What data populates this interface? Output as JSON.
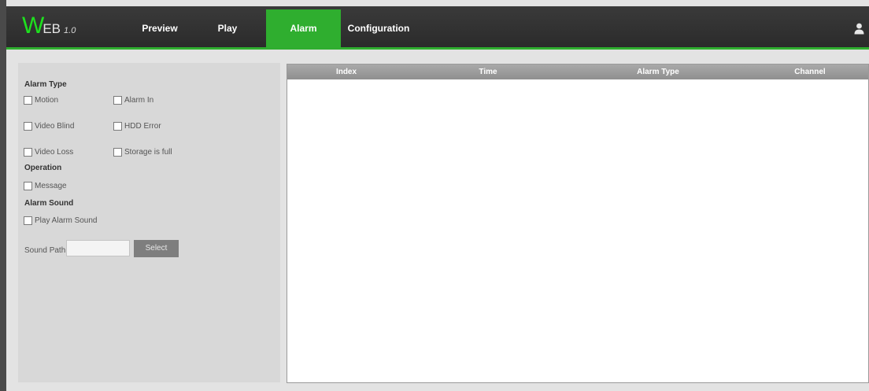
{
  "logo": {
    "letter": "W",
    "text": "EB",
    "version": "1.0"
  },
  "nav": {
    "tabs": [
      {
        "label": "Preview"
      },
      {
        "label": "Play"
      },
      {
        "label": "Alarm",
        "active": true
      },
      {
        "label": "Configuration"
      }
    ]
  },
  "header_icons": {
    "user": "user-icon"
  },
  "sidebar": {
    "alarm_type_title": "Alarm Type",
    "alarm_types": [
      {
        "label": "Motion",
        "checked": false
      },
      {
        "label": "Alarm In",
        "checked": false
      },
      {
        "label": "Video Blind",
        "checked": false
      },
      {
        "label": "HDD Error",
        "checked": false
      },
      {
        "label": "Video Loss",
        "checked": false
      },
      {
        "label": "Storage is full",
        "checked": false
      }
    ],
    "operation_title": "Operation",
    "operation": {
      "label": "Message",
      "checked": false
    },
    "alarm_sound_title": "Alarm Sound",
    "alarm_sound": {
      "label": "Play Alarm Sound",
      "checked": false
    },
    "sound_path_label": "Sound Path",
    "sound_path_value": "",
    "select_button": "Select"
  },
  "table": {
    "columns": [
      "Index",
      "Time",
      "Alarm Type",
      "Channel"
    ],
    "rows": []
  },
  "colors": {
    "accent": "#2fae2f",
    "header_bg": "#2f2f2f",
    "panel_bg": "#d8d8d8",
    "table_header": "#9a9a9a"
  }
}
